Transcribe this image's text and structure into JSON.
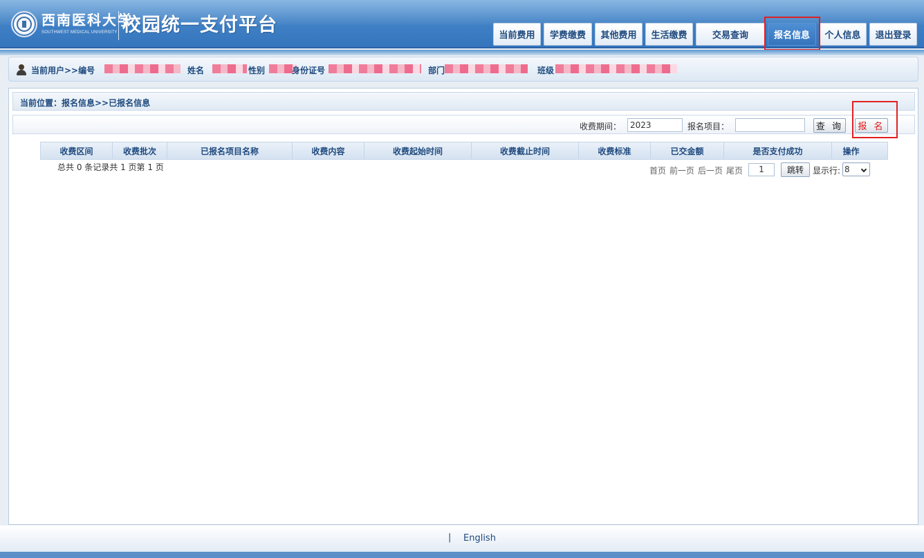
{
  "header": {
    "university_cn": "西南医科大学",
    "university_en": "SOUTHWEST MEDICAL UNIVERSITY",
    "platform_title": "校园统一支付平台",
    "nav": [
      {
        "label": "当前费用"
      },
      {
        "label": "学费缴费"
      },
      {
        "label": "其他费用"
      },
      {
        "label": "生活缴费"
      },
      {
        "label": "交易查询"
      },
      {
        "label": "报名信息",
        "active": true
      },
      {
        "label": "个人信息"
      },
      {
        "label": "退出登录"
      }
    ]
  },
  "userbar": {
    "prefix": "当前用户>>编号",
    "name_label": "姓名",
    "gender_label": "性别",
    "id_label": "身份证号",
    "dept_label": "部门",
    "class_label": "班级"
  },
  "location": {
    "text": "当前位置：报名信息>>已报名信息"
  },
  "search": {
    "period_label": "收费期间：",
    "period_value": "2023",
    "project_label": "报名项目：",
    "project_value": "",
    "query_button": "查 询",
    "signup_button": "报 名"
  },
  "table": {
    "columns": [
      "收费区间",
      "收费批次",
      "已报名项目名称",
      "收费内容",
      "收费起始时间",
      "收费截止时间",
      "收费标准",
      "已交金额",
      "是否支付成功",
      "操作"
    ],
    "rows": []
  },
  "pagination": {
    "summary": "总共 0 条记录共 1 页第 1 页",
    "first": "首页",
    "prev": "前一页",
    "next": "后一页",
    "last": "尾页",
    "page_value": "1",
    "jump": "跳转",
    "rows_label": "显示行:",
    "rows_value": "8"
  },
  "footer": {
    "separator": "|",
    "language": "English"
  },
  "colors": {
    "header_blue": "#3f7fc4",
    "nav_text": "#1f4a7e",
    "highlight_red": "#e02020"
  }
}
